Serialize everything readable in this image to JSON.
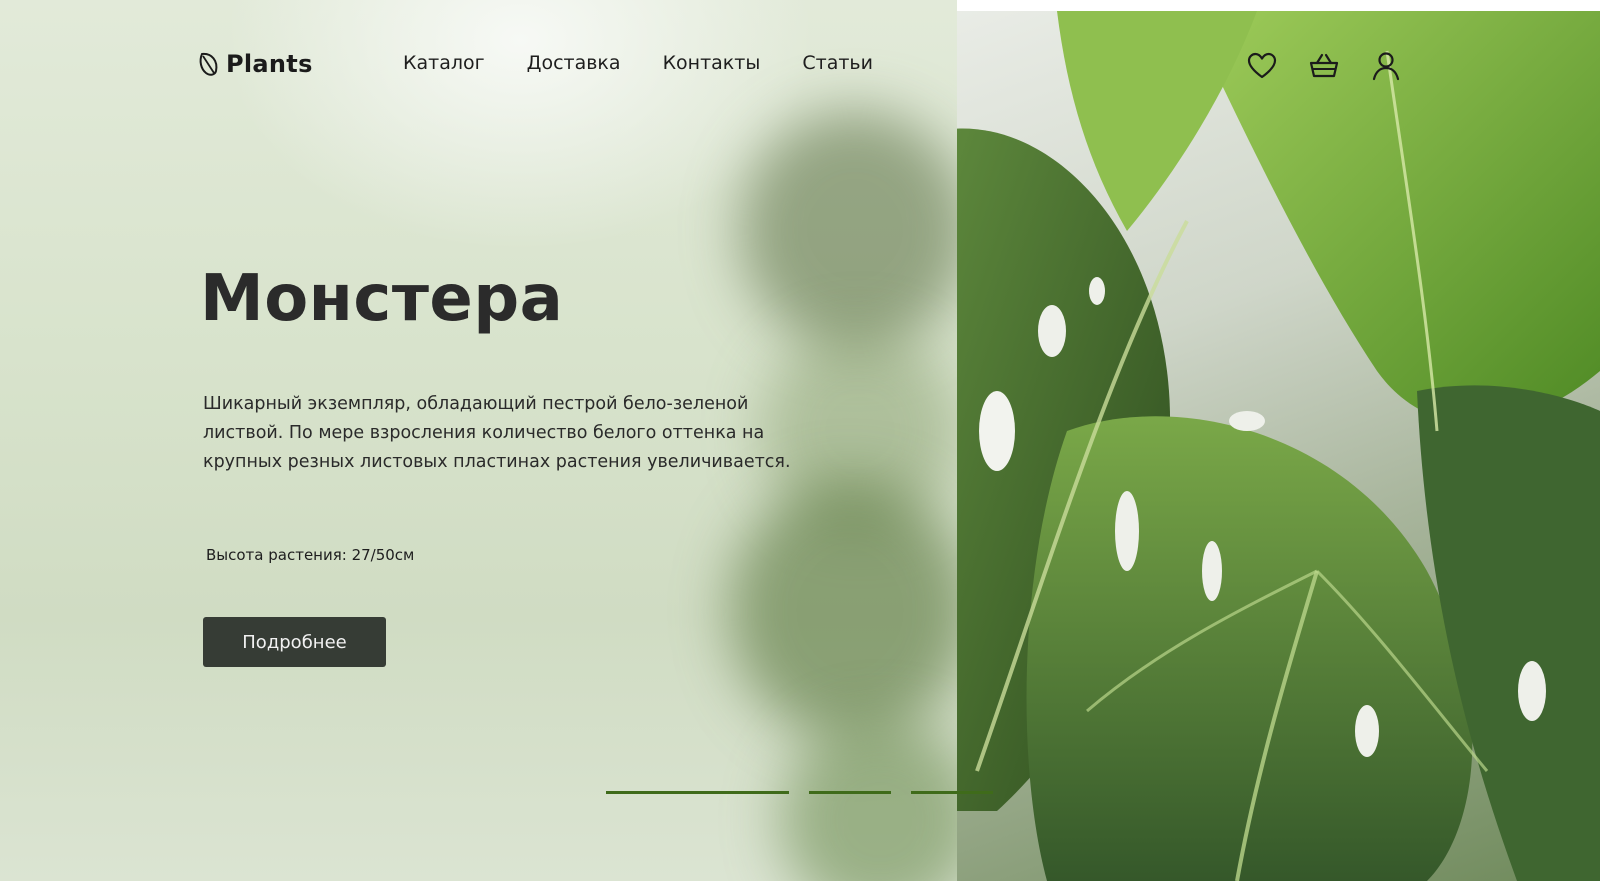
{
  "header": {
    "logo_text": "Plants",
    "nav": [
      {
        "label": "Каталог"
      },
      {
        "label": "Доставка"
      },
      {
        "label": "Контакты"
      },
      {
        "label": "Статьи"
      }
    ],
    "icons": [
      "heart-icon",
      "basket-icon",
      "user-icon"
    ]
  },
  "hero": {
    "title": "Монстера",
    "description": "Шикарный экземпляр, обладающий пестрой бело-зеленой листвой. По мере взросления количество белого оттенка на крупных резных листовых пластинах растения увеличивается.",
    "height_label": "Высота растения: 27/50см",
    "button_label": "Подробнее"
  },
  "slider": {
    "count": 3,
    "active_index": 0
  },
  "colors": {
    "accent_green": "#3f6b1a",
    "button_bg": "#363c35",
    "text_dark": "#2b2b2b"
  }
}
